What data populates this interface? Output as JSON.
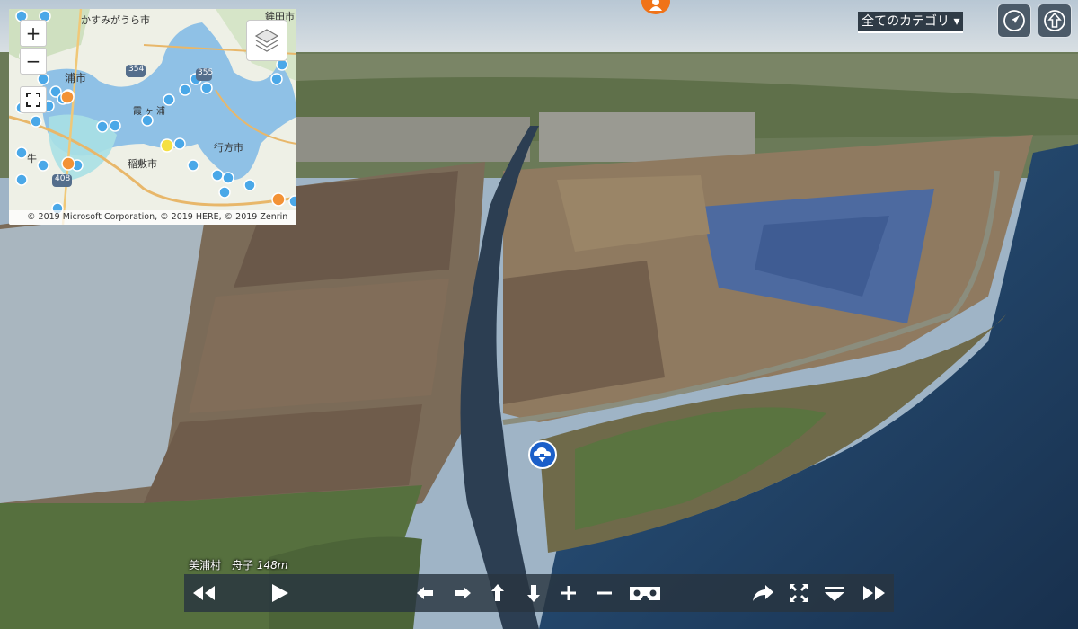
{
  "minimap": {
    "zoom_in": "+",
    "zoom_out": "−",
    "labels": {
      "city1": "かすみがうら市",
      "city2": "鉾田市",
      "city3": "浦市",
      "lake": "霞ヶ浦",
      "city4": "行方市",
      "city5": "稲敷市",
      "city6": "牛",
      "road1": "354",
      "road2": "408",
      "road3": "355"
    },
    "copyright": "© 2019 Microsoft Corporation, © 2019 HERE, © 2019 Zenrin"
  },
  "header": {
    "category_label": "全てのカテゴリ ▾"
  },
  "location": {
    "place": "美浦村　舟子",
    "altitude": "148m"
  },
  "colors": {
    "toolbar_bg": "#283440",
    "hotspot": "#1b5fc9",
    "marker_orange": "#f07318",
    "map_pin_blue": "#4aa8e8"
  }
}
